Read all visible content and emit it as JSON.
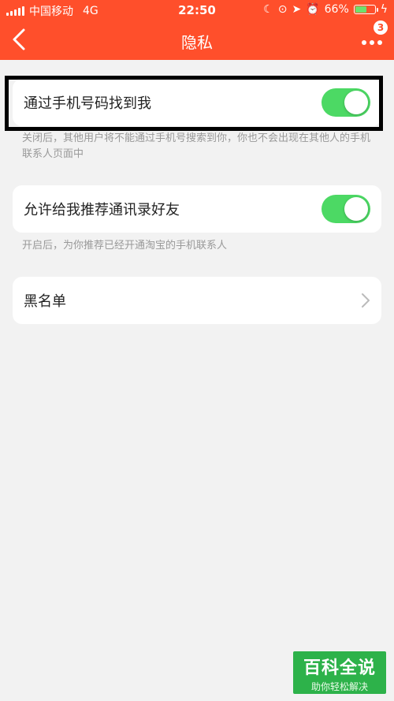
{
  "status_bar": {
    "carrier": "中国移动",
    "network": "4G",
    "time": "22:50",
    "battery": "66%",
    "battery_level": 0.66
  },
  "nav": {
    "title": "隐私",
    "badge_count": "3"
  },
  "settings": [
    {
      "label": "通过手机号码找到我",
      "toggle_on": true,
      "hint": "关闭后，其他用户将不能通过手机号搜索到你，你也不会出现在其他人的手机联系人页面中"
    },
    {
      "label": "允许给我推荐通讯录好友",
      "toggle_on": true,
      "hint": "开启后，为你推荐已经开通淘宝的手机联系人"
    },
    {
      "label": "黑名单"
    }
  ],
  "watermark": {
    "title": "百科全说",
    "subtitle": "助你轻松解决"
  },
  "colors": {
    "header_bg": "#ff4f2b",
    "toggle_on": "#4cd964",
    "page_bg": "#f2f2f2",
    "watermark_bg": "#2db24a"
  }
}
